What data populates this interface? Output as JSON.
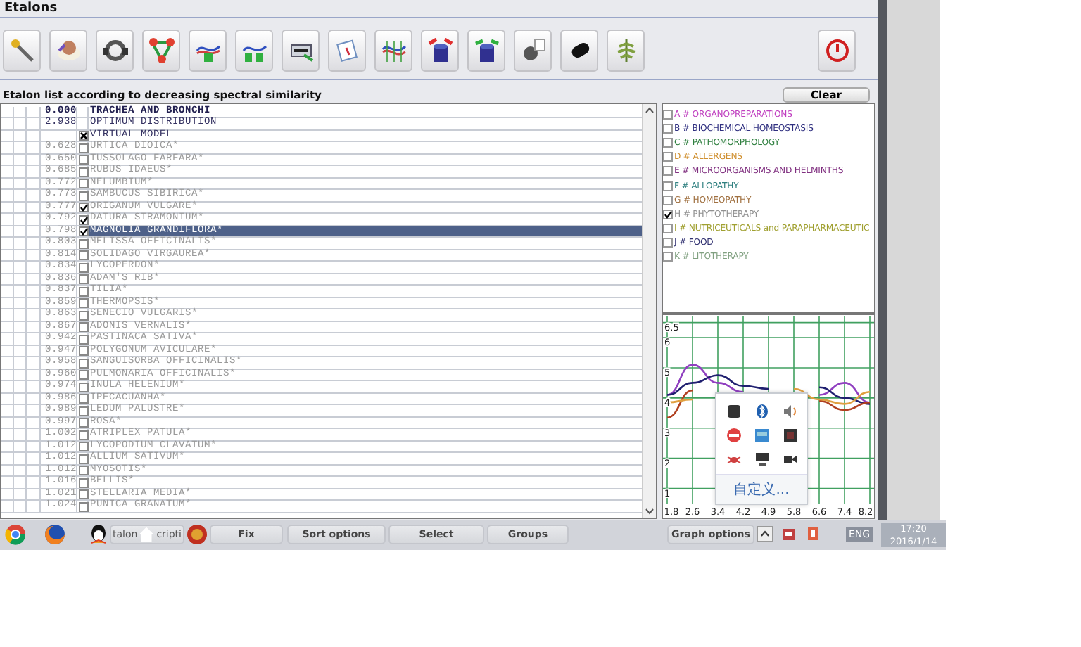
{
  "window": {
    "title": "Etalons"
  },
  "list_title": "Etalon list according to decreasing spectral similarity",
  "clear_button": "Clear",
  "rows": [
    {
      "kind": "target",
      "value": "0.000",
      "name": "TRACHEA AND BRONCHI",
      "selected": false
    },
    {
      "kind": "reference",
      "value": "2.938",
      "name": "OPTIMUM DISTRIBUTION",
      "selected": false
    },
    {
      "kind": "model",
      "name": "VIRTUAL MODEL",
      "checked": true,
      "selected": false
    },
    {
      "kind": "etalon",
      "value": "0.628",
      "name": "URTICA DIOICA*",
      "checked": false,
      "selected": false
    },
    {
      "kind": "etalon",
      "value": "0.650",
      "name": "TUSSOLAGO FARFARA*",
      "checked": false,
      "selected": false
    },
    {
      "kind": "etalon",
      "value": "0.685",
      "name": "RUBUS IDAEUS*",
      "checked": false,
      "selected": false
    },
    {
      "kind": "etalon",
      "value": "0.772",
      "name": "NELUMBIUM*",
      "checked": false,
      "selected": false
    },
    {
      "kind": "etalon",
      "value": "0.773",
      "name": "SAMBUCUS SIBIRICA*",
      "checked": false,
      "selected": false
    },
    {
      "kind": "etalon",
      "value": "0.777",
      "name": "ORIGANUM VULGARE*",
      "checked": true,
      "selected": false
    },
    {
      "kind": "etalon",
      "value": "0.792",
      "name": "DATURA STRAMONIUM*",
      "checked": true,
      "selected": false
    },
    {
      "kind": "etalon",
      "value": "0.798",
      "name": "MAGNOLIA GRANDIFLORA*",
      "checked": true,
      "selected": true
    },
    {
      "kind": "etalon",
      "value": "0.803",
      "name": "MELISSA OFFICINALIS*",
      "checked": false,
      "selected": false
    },
    {
      "kind": "etalon",
      "value": "0.814",
      "name": "SOLIDAGO VIRGAUREA*",
      "checked": false,
      "selected": false
    },
    {
      "kind": "etalon",
      "value": "0.834",
      "name": "LYCOPERDON*",
      "checked": false,
      "selected": false
    },
    {
      "kind": "etalon",
      "value": "0.836",
      "name": "ADAM'S RIB*",
      "checked": false,
      "selected": false
    },
    {
      "kind": "etalon",
      "value": "0.837",
      "name": "TILIA*",
      "checked": false,
      "selected": false
    },
    {
      "kind": "etalon",
      "value": "0.859",
      "name": "THERMOPSIS*",
      "checked": false,
      "selected": false
    },
    {
      "kind": "etalon",
      "value": "0.863",
      "name": "SENECIO VULGARIS*",
      "checked": false,
      "selected": false
    },
    {
      "kind": "etalon",
      "value": "0.867",
      "name": "ADONIS VERNALIS*",
      "checked": false,
      "selected": false
    },
    {
      "kind": "etalon",
      "value": "0.942",
      "name": "PASTINACA SATIVA*",
      "checked": false,
      "selected": false
    },
    {
      "kind": "etalon",
      "value": "0.947",
      "name": "POLYGONUM AVICULARE*",
      "checked": false,
      "selected": false
    },
    {
      "kind": "etalon",
      "value": "0.958",
      "name": "SANGUISORBA OFFICINALIS*",
      "checked": false,
      "selected": false
    },
    {
      "kind": "etalon",
      "value": "0.960",
      "name": "PULMONARIA OFFICINALIS*",
      "checked": false,
      "selected": false
    },
    {
      "kind": "etalon",
      "value": "0.974",
      "name": "INULA HELENIUM*",
      "checked": false,
      "selected": false
    },
    {
      "kind": "etalon",
      "value": "0.986",
      "name": "IPECACUANHA*",
      "checked": false,
      "selected": false
    },
    {
      "kind": "etalon",
      "value": "0.989",
      "name": "LEDUM PALUSTRE*",
      "checked": false,
      "selected": false
    },
    {
      "kind": "etalon",
      "value": "0.997",
      "name": "ROSA*",
      "checked": false,
      "selected": false
    },
    {
      "kind": "etalon",
      "value": "1.002",
      "name": "ATRIPLEX PATULA*",
      "checked": false,
      "selected": false
    },
    {
      "kind": "etalon",
      "value": "1.012",
      "name": "LYCOPODIUM CLAVATUM*",
      "checked": false,
      "selected": false
    },
    {
      "kind": "etalon",
      "value": "1.012",
      "name": "ALLIUM SATIVUM*",
      "checked": false,
      "selected": false
    },
    {
      "kind": "etalon",
      "value": "1.012",
      "name": "MYOSOTIS*",
      "checked": false,
      "selected": false
    },
    {
      "kind": "etalon",
      "value": "1.016",
      "name": "BELLIS*",
      "checked": false,
      "selected": false
    },
    {
      "kind": "etalon",
      "value": "1.021",
      "name": "STELLARIA MEDIA*",
      "checked": false,
      "selected": false
    },
    {
      "kind": "etalon",
      "value": "1.024",
      "name": "PUNICA GRANATUM*",
      "checked": false,
      "selected": false
    }
  ],
  "groups": [
    {
      "label": "A # ORGANOPREPARATIONS",
      "checked": false,
      "color": "#c040c0"
    },
    {
      "label": "B # BIOCHEMICAL HOMEOSTASIS",
      "checked": false,
      "color": "#303080"
    },
    {
      "label": "C # PATHOMORPHOLOGY",
      "checked": false,
      "color": "#308040"
    },
    {
      "label": "D # ALLERGENS",
      "checked": false,
      "color": "#d09030"
    },
    {
      "label": "E # MICROORGANISMS AND HELMINTHS",
      "checked": false,
      "color": "#803080"
    },
    {
      "label": "F # ALLOPATHY",
      "checked": false,
      "color": "#308080"
    },
    {
      "label": "G # HOMEOPATHY",
      "checked": false,
      "color": "#a07040"
    },
    {
      "label": "H # PHYTOTHERAPY",
      "checked": true,
      "color": "#909090"
    },
    {
      "label": "I # NUTRICEUTICALS and PARAPHARMACEUTIC",
      "checked": false,
      "color": "#a0a030"
    },
    {
      "label": "J # FOOD",
      "checked": false,
      "color": "#303070"
    },
    {
      "label": "K # LITOTHERAPY",
      "checked": false,
      "color": "#80a080"
    }
  ],
  "graph": {
    "chart_data": {
      "type": "line",
      "grid": true,
      "categories": [
        "1.8",
        "2.6",
        "3.4",
        "4.2",
        "4.9",
        "5.8",
        "6.6",
        "7.4",
        "8.2"
      ],
      "ylim": [
        0.5,
        6.7
      ],
      "yticks": [
        1,
        2,
        3,
        4,
        5,
        6,
        6.5
      ],
      "series": [
        {
          "color": "#9040c0",
          "values": [
            4.1,
            5.1,
            4.5,
            4.2,
            null,
            null,
            4.1,
            4.5,
            3.85
          ]
        },
        {
          "color": "#202070",
          "values": [
            4.1,
            4.5,
            4.75,
            4.4,
            4.3,
            null,
            4.35,
            4.0,
            3.8
          ]
        },
        {
          "color": "#b04020",
          "values": [
            3.35,
            4.25,
            null,
            null,
            null,
            null,
            3.9,
            3.6,
            3.85
          ]
        },
        {
          "color": "#e0a040",
          "values": [
            3.85,
            3.95,
            null,
            null,
            null,
            4.3,
            3.95,
            3.8,
            4.2
          ]
        }
      ]
    }
  },
  "bottom_bar": {
    "first_button_fragments": [
      "talon",
      "cripti"
    ],
    "buttons": [
      "Fix",
      "Sort options",
      "Select",
      "Groups"
    ],
    "graph_button": "Graph options",
    "language": "ENG",
    "time": "17:20",
    "date": "2016/1/14"
  },
  "tray_popup": {
    "link": "自定义..."
  }
}
